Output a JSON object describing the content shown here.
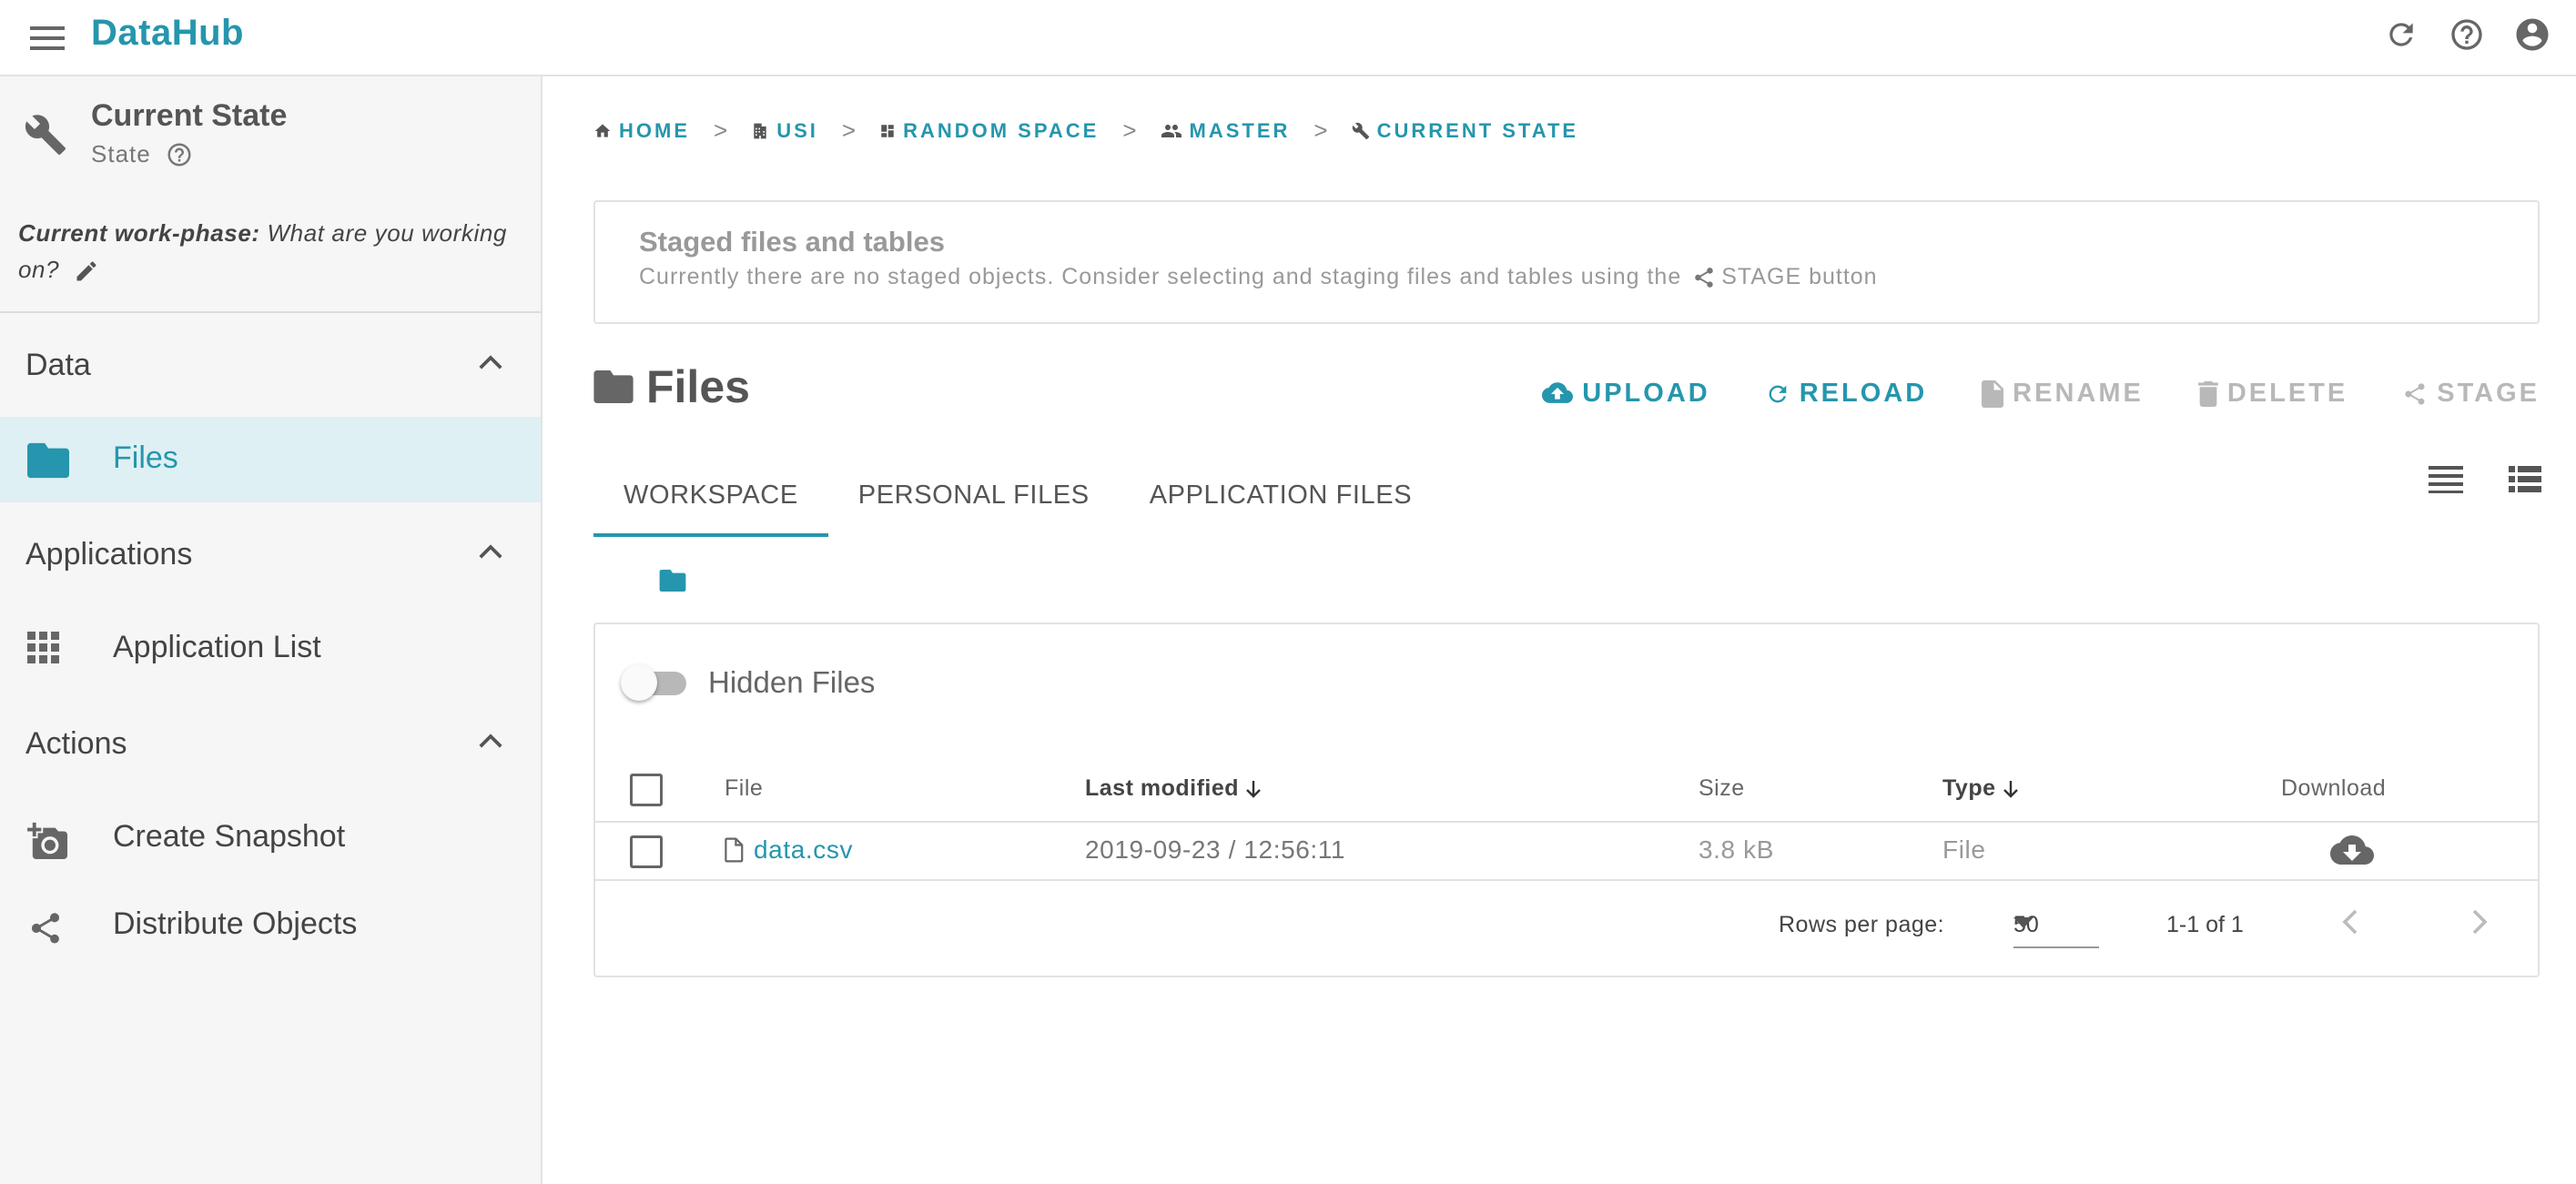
{
  "app": {
    "title": "DataHub"
  },
  "colors": {
    "accent": "#2596ad",
    "muted": "#b8b8b8",
    "active_bg": "#dff0f4"
  },
  "appbar": {
    "icons": [
      "menu-icon",
      "refresh-icon",
      "help-icon",
      "account-icon"
    ]
  },
  "sidebar": {
    "state_title": "Current State",
    "state_subtitle": "State",
    "workphase_label": "Current work-phase:",
    "workphase_value": "What are you working on?",
    "sections": [
      {
        "label": "Data",
        "items": [
          {
            "label": "Files",
            "icon": "folder-icon",
            "active": true
          }
        ]
      },
      {
        "label": "Applications",
        "items": [
          {
            "label": "Application List",
            "icon": "apps-grid-icon"
          }
        ]
      },
      {
        "label": "Actions",
        "items": [
          {
            "label": "Create Snapshot",
            "icon": "add-camera-icon"
          },
          {
            "label": "Distribute Objects",
            "icon": "share-icon"
          }
        ]
      }
    ]
  },
  "breadcrumb": [
    {
      "label": "HOME",
      "icon": "home-icon"
    },
    {
      "label": "USI",
      "icon": "building-icon"
    },
    {
      "label": "RANDOM SPACE",
      "icon": "dashboard-icon"
    },
    {
      "label": "MASTER",
      "icon": "people-icon"
    },
    {
      "label": "CURRENT STATE",
      "icon": "wrench-icon"
    }
  ],
  "staged": {
    "title": "Staged files and tables",
    "text": "Currently there are no staged objects. Consider selecting and staging files and tables using the",
    "button_ref": "STAGE button"
  },
  "files": {
    "title": "Files",
    "actions": [
      {
        "label": "UPLOAD",
        "icon": "cloud-upload-icon",
        "enabled": true
      },
      {
        "label": "RELOAD",
        "icon": "refresh-icon",
        "enabled": true
      },
      {
        "label": "RENAME",
        "icon": "file-icon",
        "enabled": false
      },
      {
        "label": "DELETE",
        "icon": "trash-icon",
        "enabled": false
      },
      {
        "label": "STAGE",
        "icon": "share-icon",
        "enabled": false
      }
    ],
    "tabs": [
      {
        "label": "WORKSPACE",
        "selected": true
      },
      {
        "label": "PERSONAL FILES",
        "selected": false
      },
      {
        "label": "APPLICATION FILES",
        "selected": false
      }
    ],
    "hidden_files_label": "Hidden Files",
    "hidden_files_on": false,
    "columns": {
      "file": "File",
      "modified": "Last modified",
      "size": "Size",
      "type": "Type",
      "download": "Download"
    },
    "rows": [
      {
        "name": "data.csv",
        "modified": "2019-09-23 / 12:56:11",
        "size": "3.8 kB",
        "type": "File"
      }
    ],
    "pagination": {
      "rows_per_page_label": "Rows per page:",
      "rows_per_page": "50",
      "range": "1-1 of 1"
    }
  }
}
